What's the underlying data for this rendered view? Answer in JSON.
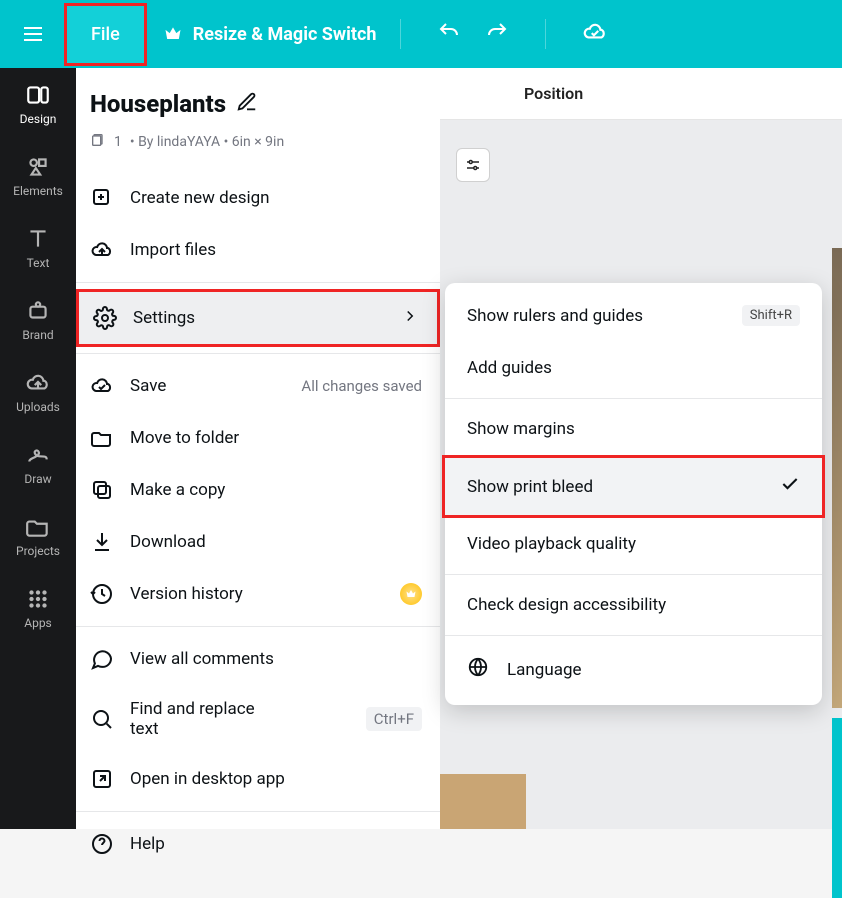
{
  "topbar": {
    "file_label": "File",
    "resize_label": "Resize & Magic Switch"
  },
  "sidebar": {
    "items": [
      {
        "label": "Design"
      },
      {
        "label": "Elements"
      },
      {
        "label": "Text"
      },
      {
        "label": "Brand"
      },
      {
        "label": "Uploads"
      },
      {
        "label": "Draw"
      },
      {
        "label": "Projects"
      },
      {
        "label": "Apps"
      }
    ]
  },
  "position_label": "Position",
  "file_menu": {
    "title": "Houseplants",
    "pages": "1",
    "meta_by": "• By lindaYAYA • 6in × 9in",
    "create": "Create new design",
    "import": "Import files",
    "settings": "Settings",
    "save": "Save",
    "save_status": "All changes saved",
    "move": "Move to folder",
    "copy": "Make a copy",
    "download": "Download",
    "history": "Version history",
    "view_comments": "View all comments",
    "find_replace": "Find and replace text",
    "find_kbd": "Ctrl+F",
    "open_desktop": "Open in desktop app",
    "help": "Help"
  },
  "submenu": {
    "rulers": "Show rulers and guides",
    "rulers_kbd": "Shift+R",
    "add_guides": "Add guides",
    "margins": "Show margins",
    "print_bleed": "Show print bleed",
    "video_quality": "Video playback quality",
    "accessibility": "Check design accessibility",
    "language": "Language"
  }
}
